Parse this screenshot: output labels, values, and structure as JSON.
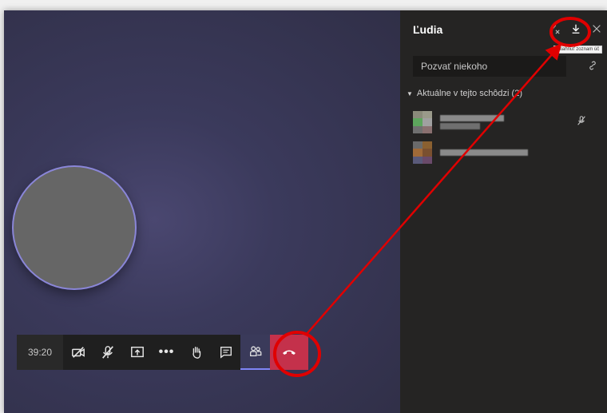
{
  "call": {
    "timer": "39:20",
    "controls": [
      {
        "icon": "camera-off-icon"
      },
      {
        "icon": "mic-off-icon"
      },
      {
        "icon": "share-screen-icon"
      },
      {
        "icon": "more-icon",
        "label": "•••"
      },
      {
        "icon": "raise-hand-icon"
      },
      {
        "icon": "chat-icon"
      },
      {
        "icon": "people-icon"
      },
      {
        "icon": "hang-up-icon"
      }
    ]
  },
  "panel": {
    "title": "Ľudia",
    "download_tooltip": "Stiahnuť zoznam úč",
    "invite_placeholder": "Pozvať niekoho",
    "section": "Aktuálne v tejto schôdzi (2)"
  },
  "colors": {
    "accent": "#7f85f5",
    "annotation": "#e00000",
    "hangup": "#c4314b"
  }
}
